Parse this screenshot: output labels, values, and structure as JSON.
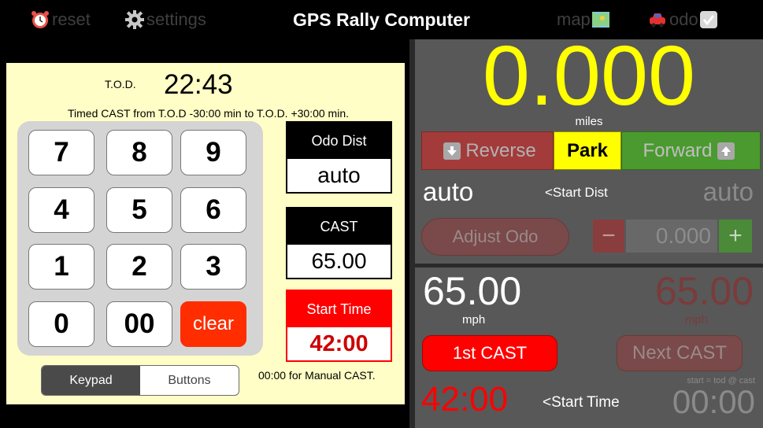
{
  "topbar": {
    "title": "GPS Rally Computer",
    "reset_label": "reset",
    "settings_label": "settings",
    "map_label": "map",
    "odo_label": "odo",
    "reset_icon": "alarm-clock-icon",
    "settings_icon": "gear-icon",
    "map_icon": "map-icon",
    "odo_icon": "car-icon",
    "odo_checkbox_icon": "checkbox-checked-icon"
  },
  "tod": {
    "label": "T.O.D.",
    "value": "22:43",
    "timed_text": "Timed CAST from T.O.D -30:00 min to T.O.D. +30:00 min."
  },
  "keypad": {
    "keys": [
      "7",
      "8",
      "9",
      "4",
      "5",
      "6",
      "1",
      "2",
      "3",
      "0",
      "00",
      "clear"
    ]
  },
  "boxes": {
    "odo_dist": {
      "label": "Odo Dist",
      "value": "auto"
    },
    "cast": {
      "label": "CAST",
      "value": "65.00"
    },
    "start_time": {
      "label": "Start Time",
      "value": "42:00"
    }
  },
  "mode_toggle": {
    "keypad_label": "Keypad",
    "buttons_label": "Buttons",
    "selected": "Keypad"
  },
  "manual_cast_note": "00:00 for Manual CAST.",
  "odometer": {
    "distance": "0.000",
    "unit": "miles",
    "reverse_label": "Reverse",
    "park_label": "Park",
    "forward_label": "Forward",
    "auto_left": "auto",
    "start_dist_label": "<Start Dist",
    "auto_right": "auto",
    "adjust_label": "Adjust Odo",
    "minus_label": "−",
    "adjust_value": "0.000",
    "plus_label": "+"
  },
  "cast_panel": {
    "current_cast": "65.00",
    "current_unit": "mph",
    "next_cast": "65.00",
    "next_unit": "mph",
    "first_cast_label": "1st CAST",
    "next_cast_label": "Next CAST",
    "start_time_red": "42:00",
    "start_time_label": "<Start Time",
    "formula": "start = tod @ cast",
    "start_time_gray": "00:00"
  },
  "colors": {
    "accent_yellow": "#ffff00",
    "accent_red": "#ff0000",
    "panel_bg": "#fffec6",
    "dark_panel": "#585858"
  }
}
